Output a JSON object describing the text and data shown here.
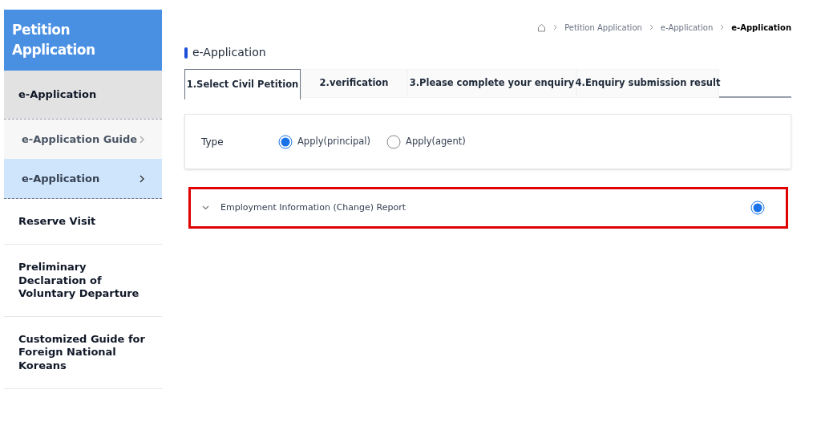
{
  "sidebar": {
    "title": "Petition Application",
    "items": [
      {
        "label": "e-Application",
        "expanded": true,
        "children": [
          {
            "label": "e-Application Guide",
            "selected": false
          },
          {
            "label": "e-Application",
            "selected": true
          }
        ]
      },
      {
        "label": "Reserve Visit",
        "expanded": false
      },
      {
        "label": "Preliminary Declaration of Voluntary Departure",
        "expanded": false
      },
      {
        "label": "Customized Guide for Foreign National Koreans",
        "expanded": false
      }
    ]
  },
  "breadcrumb": [
    "Petition Application",
    "e-Application",
    "e-Application"
  ],
  "page_title": "e-Application",
  "tabs": [
    {
      "label": "1.Select Civil Petition",
      "selected": true
    },
    {
      "label": "2.verification",
      "selected": false
    },
    {
      "label": "3.Please complete your enquiry",
      "selected": false
    },
    {
      "label": "4.Enquiry submission result",
      "selected": false
    }
  ],
  "type_field": {
    "label": "Type",
    "options": [
      {
        "label": "Apply(principal)",
        "selected": true
      },
      {
        "label": "Apply(agent)",
        "selected": false
      }
    ]
  },
  "petitions": [
    {
      "label": "Employment Information (Change) Report",
      "selected": true,
      "highlighted": true
    }
  ]
}
